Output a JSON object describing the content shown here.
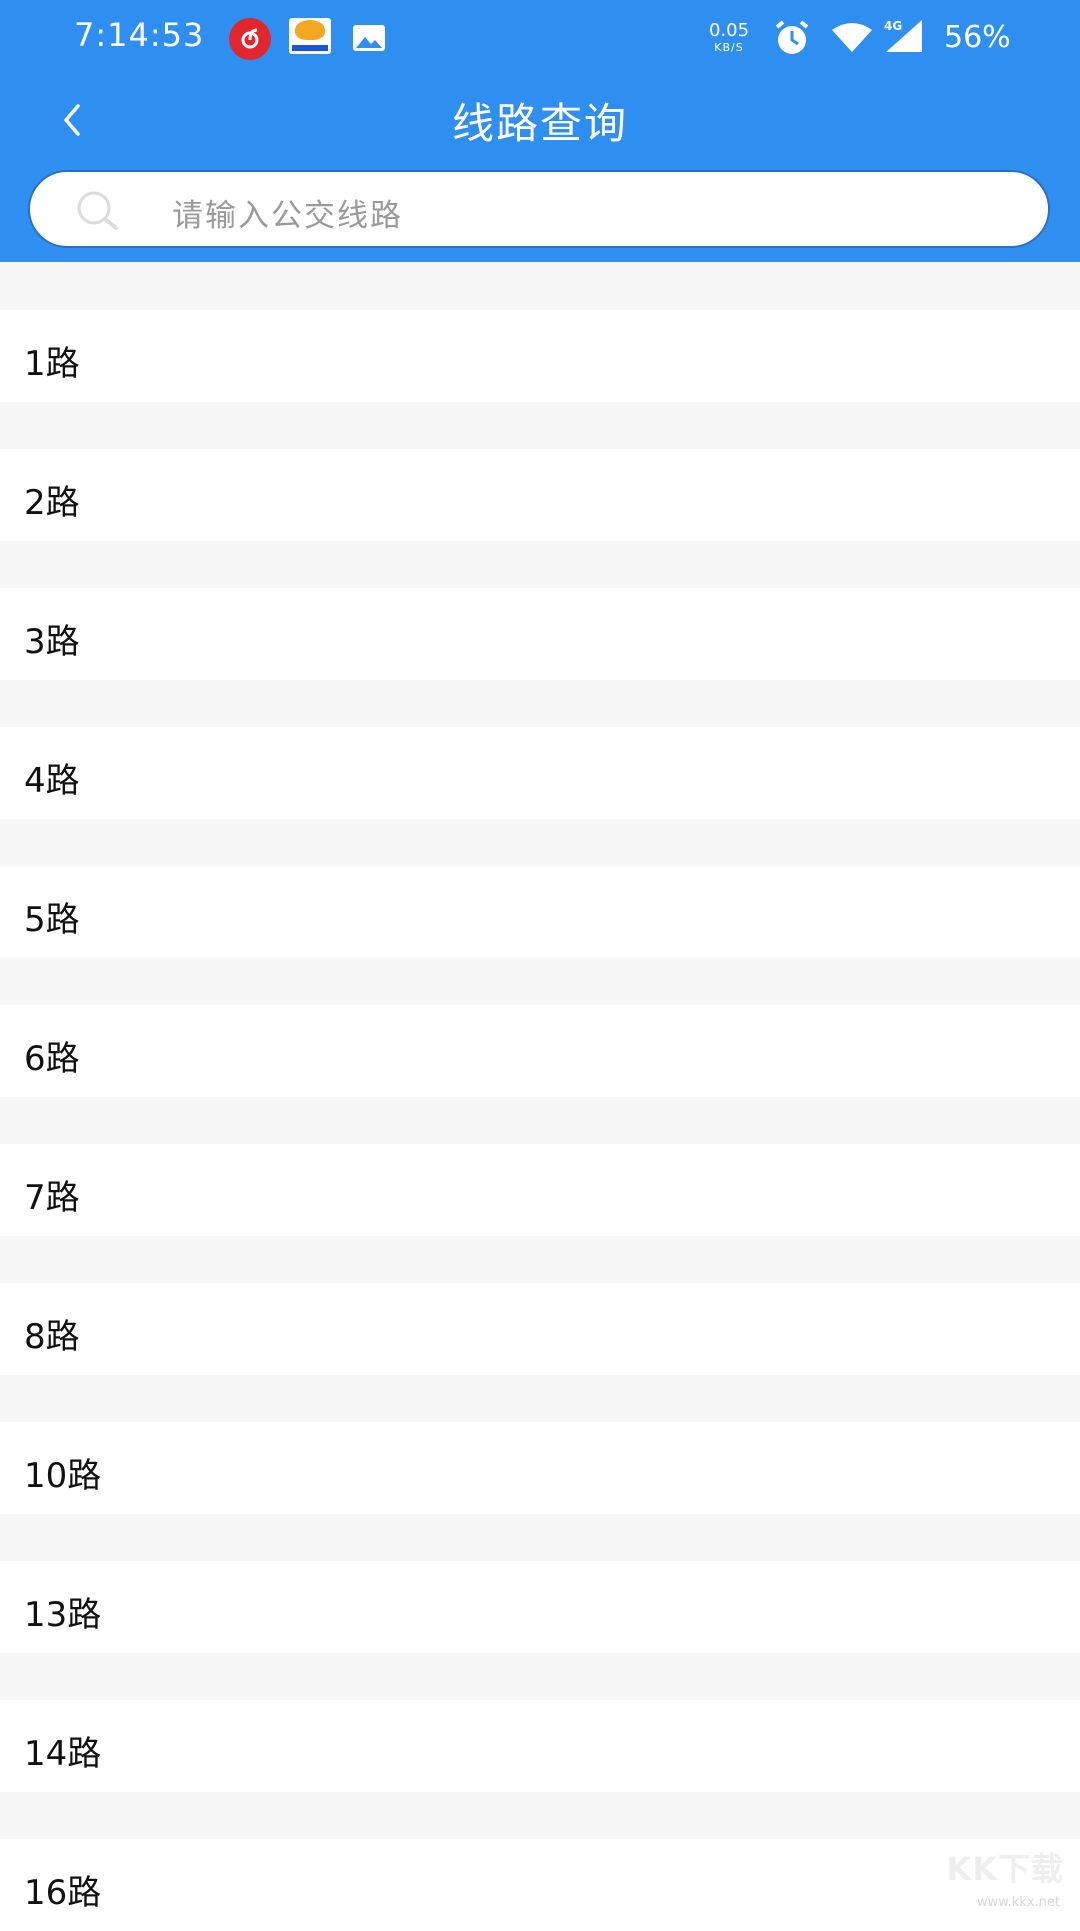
{
  "status_bar": {
    "time": "7:14:53",
    "net_speed_value": "0.05",
    "net_speed_unit": "KB/S",
    "network_type": "4G",
    "battery": "56%",
    "icons": [
      "netease-music-icon",
      "game-app-icon",
      "gallery-icon",
      "alarm-icon",
      "wifi-icon",
      "signal-4g-icon"
    ]
  },
  "header": {
    "title": "线路查询",
    "back_icon": "chevron-left-icon",
    "background": "#2f8ff0"
  },
  "search": {
    "placeholder": "请输入公交线路",
    "icon": "search-icon"
  },
  "routes": [
    {
      "label": "1路"
    },
    {
      "label": "2路"
    },
    {
      "label": "3路"
    },
    {
      "label": "4路"
    },
    {
      "label": "5路"
    },
    {
      "label": "6路"
    },
    {
      "label": "7路"
    },
    {
      "label": "8路"
    },
    {
      "label": "10路"
    },
    {
      "label": "13路"
    },
    {
      "label": "14路"
    },
    {
      "label": "16路"
    }
  ],
  "watermark": {
    "text": "KK下载",
    "sub": "www.kkx.net"
  }
}
